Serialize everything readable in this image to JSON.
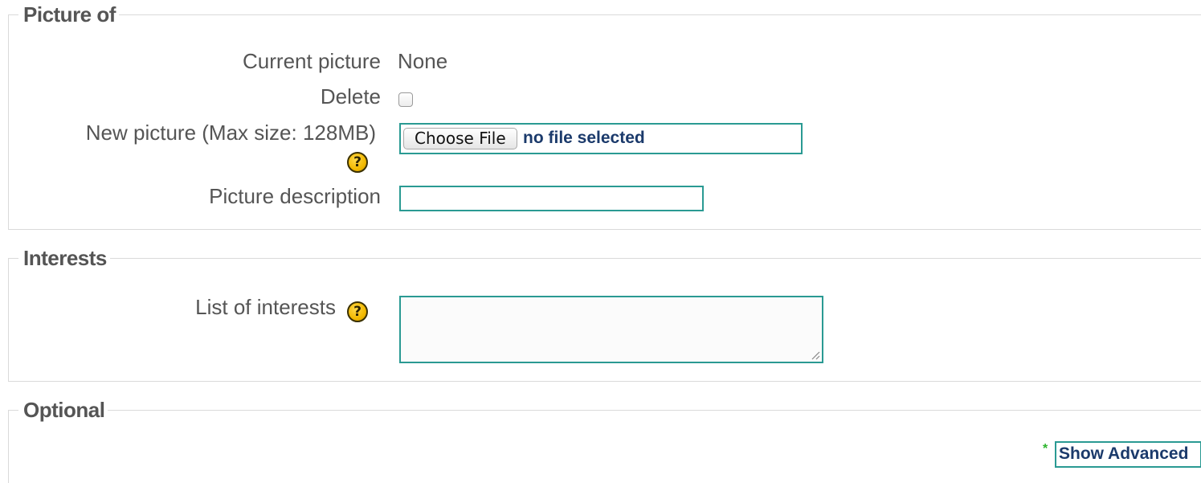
{
  "sections": {
    "picture": {
      "legend": "Picture of",
      "current_picture_label": "Current picture",
      "current_picture_value": "None",
      "delete_label": "Delete",
      "delete_checked": false,
      "new_picture_label": "New picture (Max size: 128MB)",
      "choose_file_button": "Choose File",
      "file_status": "no file selected",
      "picture_description_label": "Picture description",
      "picture_description_value": ""
    },
    "interests": {
      "legend": "Interests",
      "list_label": "List of interests",
      "list_value": ""
    },
    "optional": {
      "legend": "Optional",
      "show_advanced_button": "Show Advanced",
      "required_marker": "*"
    }
  },
  "icons": {
    "help": "help-icon",
    "help_glyph": "?"
  },
  "colors": {
    "input_border": "#2a9a93",
    "link_text": "#1b3a6b",
    "help_icon": "#f2b900",
    "star_marker": "#2db52d"
  }
}
